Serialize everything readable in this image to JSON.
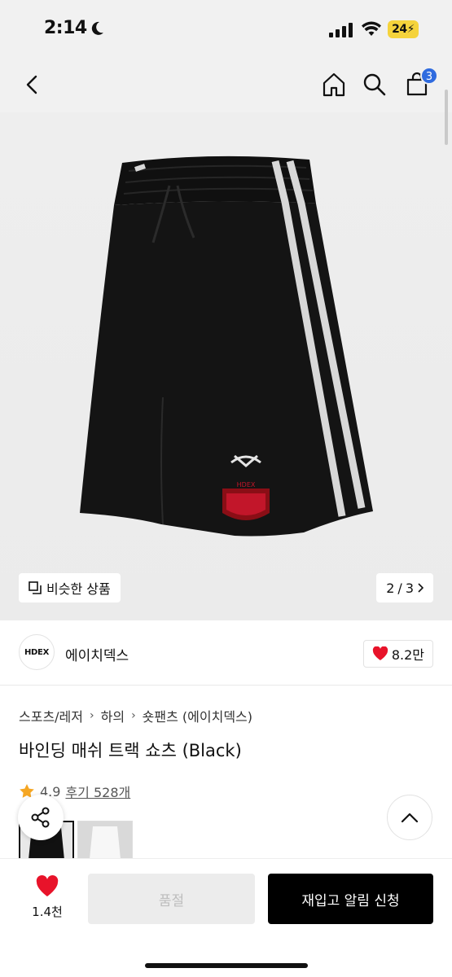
{
  "status_bar": {
    "time": "2:14",
    "battery": "24"
  },
  "header": {
    "cart_count": "3"
  },
  "gallery": {
    "similar_label": "비슷한 상품",
    "page_current": "2",
    "page_separator": "/",
    "page_total": "3",
    "product_logo_text": "HDEX"
  },
  "brand": {
    "logo_text": "HDEX",
    "name": "에이치덱스",
    "likes": "8.2만"
  },
  "breadcrumb": [
    "스포츠/레저",
    "하의",
    "숏팬츠 (에이치덱스)"
  ],
  "product": {
    "title": "바인딩 매쉬 트랙 쇼츠 (Black)",
    "rating": "4.9",
    "reviews": "후기 528개"
  },
  "bottom_bar": {
    "wish_count": "1.4천",
    "soldout_label": "품절",
    "restock_label": "재입고 알림 신청"
  },
  "colors": {
    "accent_heart": "#e8132a",
    "badge_blue": "#2f6bdf",
    "battery_yellow": "#f5d33c",
    "star": "#f5a623"
  }
}
